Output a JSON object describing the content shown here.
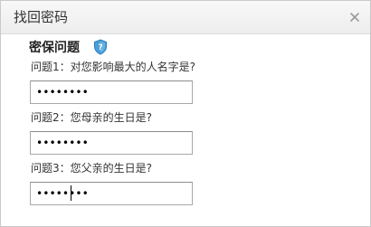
{
  "dialog": {
    "title": "找回密码",
    "close_icon": "close-icon"
  },
  "section": {
    "title": "密保问题",
    "badge_icon": "shield-question-icon",
    "badge_color": "#4a9fd8"
  },
  "questions": [
    {
      "label": "问题1：对您影响最大的人名字是?",
      "value": "••••••••"
    },
    {
      "label": "问题2：您母亲的生日是?",
      "value": "••••••••"
    },
    {
      "label": "问题3：您父亲的生日是?",
      "value": "••••••••"
    }
  ]
}
